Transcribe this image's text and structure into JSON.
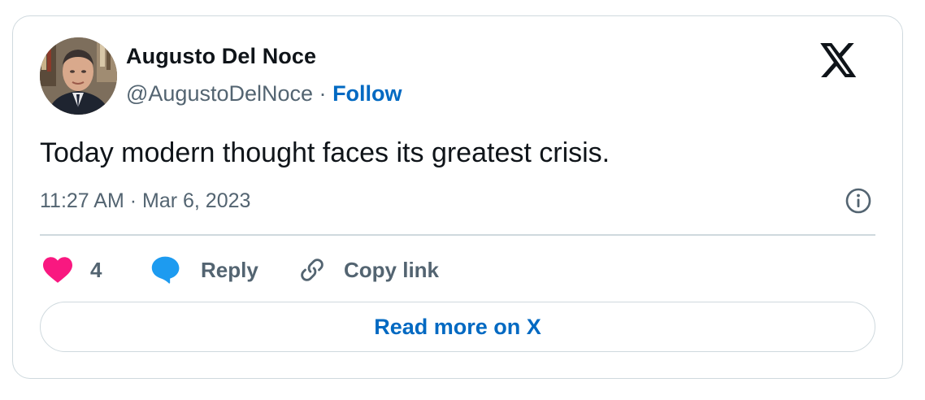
{
  "author": {
    "name": "Augusto Del Noce",
    "handle": "@AugustoDelNoce",
    "separator": "·",
    "follow_label": "Follow"
  },
  "tweet": {
    "text": "Today modern thought faces its greatest crisis.",
    "timestamp": "11:27 AM · Mar 6, 2023"
  },
  "actions": {
    "like_count": "4",
    "reply_label": "Reply",
    "copy_label": "Copy link"
  },
  "footer": {
    "read_more_label": "Read more on X"
  },
  "icons": {
    "brand": "x-logo-icon",
    "like": "heart-icon",
    "reply": "speech-bubble-icon",
    "copy": "link-icon",
    "info": "info-icon"
  },
  "colors": {
    "accent": "#0069c2",
    "heart": "#f91880",
    "reply_bubble": "#1d9bf0",
    "text": "#0f1419",
    "muted": "#536471",
    "border": "#cfd9de"
  }
}
